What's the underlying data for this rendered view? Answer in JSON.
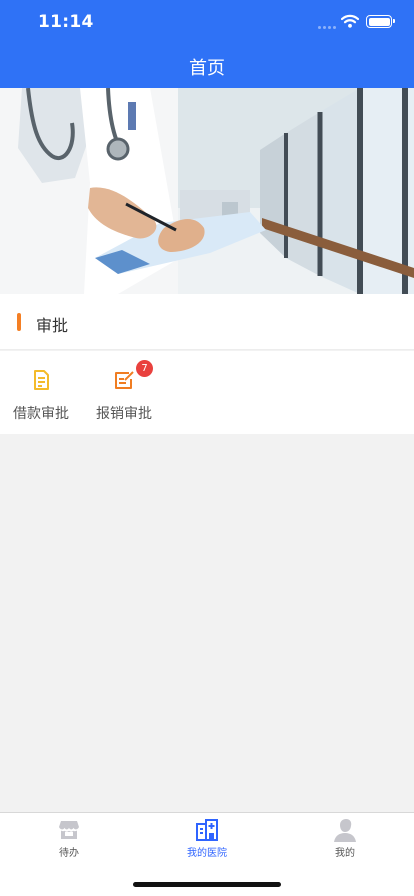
{
  "status_bar": {
    "time": "11:14",
    "icons": [
      "signal-icon",
      "wifi-icon",
      "battery-icon"
    ]
  },
  "header": {
    "title": "首页"
  },
  "banner": {
    "image": "doctor-hospital-corridor",
    "dots": 1,
    "active_dot": 0
  },
  "section": {
    "title": "审批"
  },
  "approvals": [
    {
      "label": "借款审批",
      "icon": "document-icon",
      "badge": ""
    },
    {
      "label": "报销审批",
      "icon": "edit-form-icon",
      "badge": "7"
    }
  ],
  "tabs": [
    {
      "label": "待办",
      "icon": "shop-icon",
      "active": false
    },
    {
      "label": "我的医院",
      "icon": "hospital-icon",
      "active": true
    },
    {
      "label": "我的",
      "icon": "user-icon",
      "active": false
    }
  ],
  "colors": {
    "primary": "#2f72f6",
    "accent": "#f47f24",
    "tab_active": "#2f64ff",
    "badge": "#e9413e"
  }
}
